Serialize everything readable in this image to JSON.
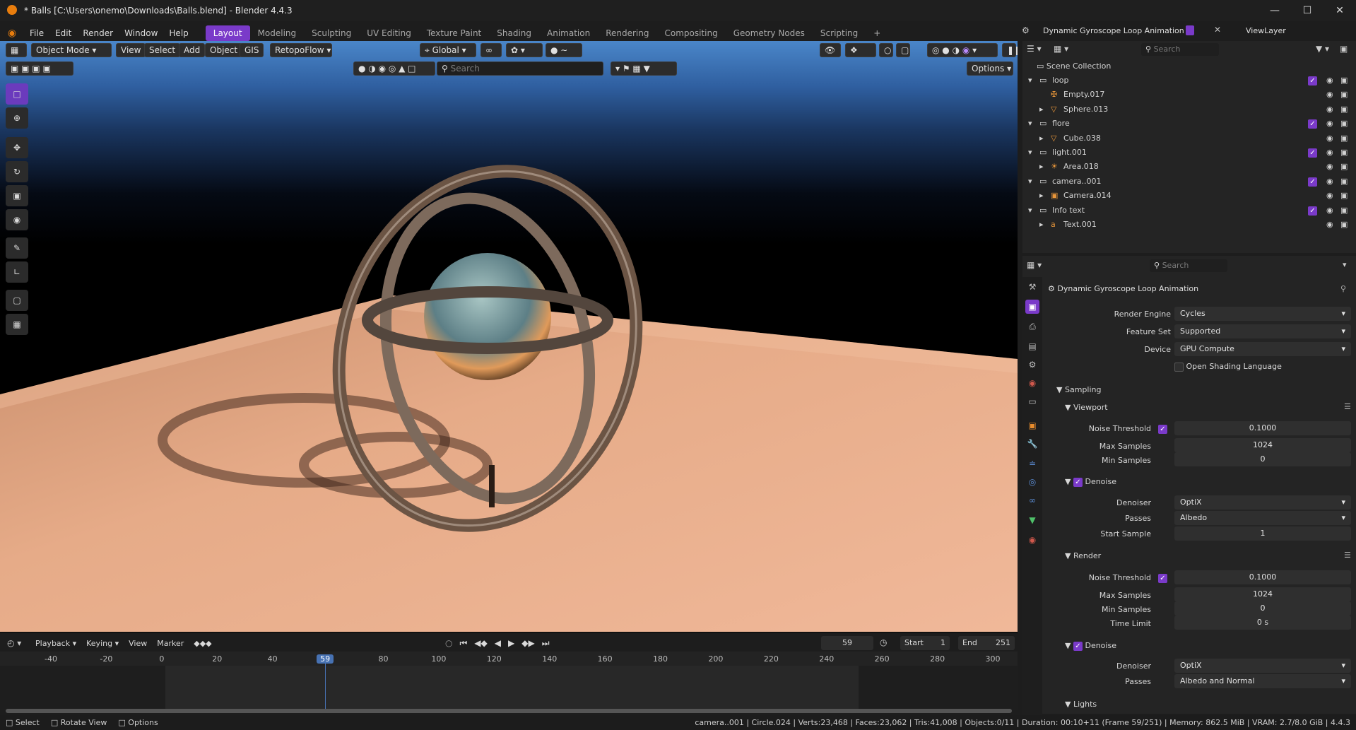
{
  "window": {
    "title": "* Balls [C:\\Users\\onemo\\Downloads\\Balls.blend] - Blender 4.4.3"
  },
  "menu": {
    "items": [
      "File",
      "Edit",
      "Render",
      "Window",
      "Help"
    ]
  },
  "workspaces": [
    {
      "label": "Layout",
      "active": true
    },
    {
      "label": "Modeling"
    },
    {
      "label": "Sculpting"
    },
    {
      "label": "UV Editing"
    },
    {
      "label": "Texture Paint"
    },
    {
      "label": "Shading"
    },
    {
      "label": "Animation"
    },
    {
      "label": "Rendering"
    },
    {
      "label": "Compositing"
    },
    {
      "label": "Geometry Nodes"
    },
    {
      "label": "Scripting"
    }
  ],
  "scene_header": {
    "scene": "Dynamic Gyroscope Loop Animation",
    "view_layer": "ViewLayer"
  },
  "viewport": {
    "mode": "Object Mode",
    "view": "View",
    "select": "Select",
    "add": "Add",
    "object": "Object",
    "gis": "GIS",
    "retopo": "RetopoFlow",
    "orientation": "Global",
    "search_placeholder": "Search",
    "options": "Options"
  },
  "outliner": {
    "search_placeholder": "Search",
    "root": "Scene Collection",
    "rows": [
      {
        "label": "loop",
        "kind": "collection"
      },
      {
        "label": "Empty.017",
        "kind": "empty"
      },
      {
        "label": "Sphere.013",
        "kind": "mesh"
      },
      {
        "label": "flore",
        "kind": "collection"
      },
      {
        "label": "Cube.038",
        "kind": "mesh"
      },
      {
        "label": "light.001",
        "kind": "collection"
      },
      {
        "label": "Area.018",
        "kind": "light"
      },
      {
        "label": "camera..001",
        "kind": "collection"
      },
      {
        "label": "Camera.014",
        "kind": "camera"
      },
      {
        "label": "Info text",
        "kind": "collection"
      },
      {
        "label": "Text.001",
        "kind": "text"
      }
    ]
  },
  "properties": {
    "search_placeholder": "Search",
    "scene_name": "Dynamic Gyroscope Loop Animation",
    "render_engine_label": "Render Engine",
    "render_engine": "Cycles",
    "feature_set_label": "Feature Set",
    "feature_set": "Supported",
    "device_label": "Device",
    "device": "GPU Compute",
    "osl_label": "Open Shading Language",
    "sampling": "Sampling",
    "viewport": "Viewport",
    "noise_threshold_label": "Noise Threshold",
    "vp_noise": "0.1000",
    "max_samples_label": "Max Samples",
    "vp_max": "1024",
    "min_samples_label": "Min Samples",
    "vp_min": "0",
    "denoise_label": "Denoise",
    "denoiser_label": "Denoiser",
    "vp_denoiser": "OptiX",
    "passes_label": "Passes",
    "vp_passes": "Albedo",
    "start_sample_label": "Start Sample",
    "vp_start": "1",
    "render": "Render",
    "r_noise": "0.1000",
    "r_max": "1024",
    "r_min": "0",
    "time_limit_label": "Time Limit",
    "r_time": "0 s",
    "r_denoiser": "OptiX",
    "r_passes": "Albedo and Normal",
    "lights": "Lights"
  },
  "timeline": {
    "menu": [
      "Playback",
      "Keying",
      "View",
      "Marker"
    ],
    "current_frame": "59",
    "start_label": "Start",
    "start": "1",
    "end_label": "End",
    "end": "251",
    "ticks": [
      "-40",
      "-20",
      "0",
      "20",
      "40",
      "59",
      "80",
      "100",
      "120",
      "140",
      "160",
      "180",
      "200",
      "220",
      "240",
      "260",
      "280",
      "300"
    ]
  },
  "status": {
    "select": "Select",
    "rotate": "Rotate View",
    "options": "Options",
    "stats": "camera..001 | Circle.024 | Verts:23,468 | Faces:23,062 | Tris:41,008 | Objects:0/11 | Duration: 00:10+11 (Frame 59/251) | Memory: 862.5 MiB | VRAM: 2.7/8.0 GiB | 4.4.3"
  },
  "colors": {
    "accent": "#7a3ac9",
    "current_frame": "#4772b3",
    "blender_orange": "#e87d0d"
  }
}
